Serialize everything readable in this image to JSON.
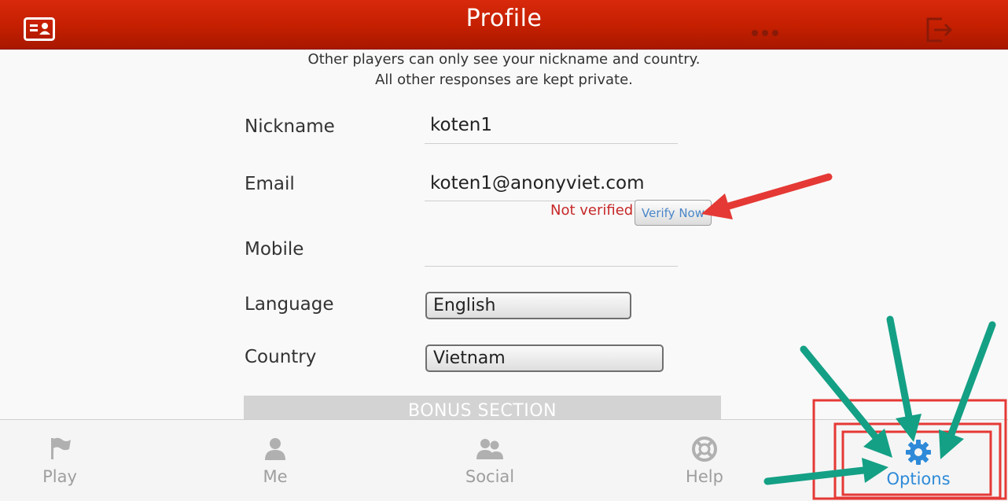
{
  "header": {
    "title": "Profile",
    "icons": [
      "profile-card-icon",
      "more-dots-icon",
      "logout-icon"
    ]
  },
  "intro": {
    "line1": "Other players can only see your nickname and country.",
    "line2": "All other responses are kept private."
  },
  "form": {
    "nickname": {
      "label": "Nickname",
      "value": "koten1"
    },
    "email": {
      "label": "Email",
      "value": "koten1@anonyviet.com",
      "status": "Not verified",
      "verify_button": "Verify Now"
    },
    "mobile": {
      "label": "Mobile",
      "value": ""
    },
    "language": {
      "label": "Language",
      "value": "English"
    },
    "country": {
      "label": "Country",
      "value": "Vietnam"
    }
  },
  "bonus_section": {
    "label": "BONUS SECTION"
  },
  "tabbar": {
    "items": [
      {
        "label": "Play",
        "icon": "flag-icon",
        "active": false
      },
      {
        "label": "Me",
        "icon": "person-icon",
        "active": false
      },
      {
        "label": "Social",
        "icon": "people-icon",
        "active": false
      },
      {
        "label": "Help",
        "icon": "lifebuoy-icon",
        "active": false
      },
      {
        "label": "Options",
        "icon": "gear-icon",
        "active": true
      }
    ]
  },
  "colors": {
    "header_red": "#c41f00",
    "active_blue": "#2e8ad8",
    "error_red": "#c62828",
    "annotation_red": "#e53935",
    "annotation_green": "#14a085"
  }
}
